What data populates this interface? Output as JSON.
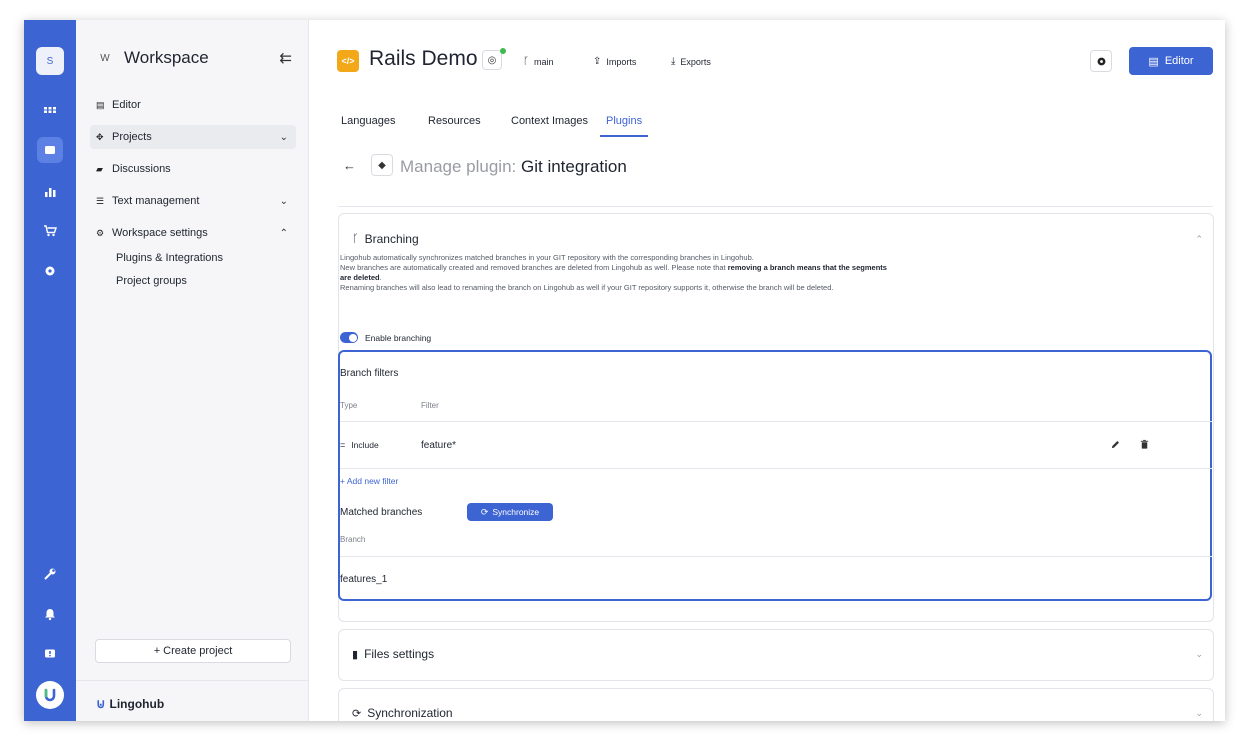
{
  "rail": {
    "avatar": "S",
    "colors": {
      "rail": "#3d64d3",
      "active": "#5d80e4"
    }
  },
  "sidebar": {
    "workspace_badge": "W",
    "workspace_title": "Workspace",
    "items": [
      {
        "label": "Editor",
        "icon": "editor-icon"
      },
      {
        "label": "Projects",
        "icon": "projects-icon",
        "expanded": false
      },
      {
        "label": "Discussions",
        "icon": "discussions-icon"
      },
      {
        "label": "Text management",
        "icon": "text-management-icon",
        "expanded": false
      },
      {
        "label": "Workspace settings",
        "icon": "settings-icon",
        "expanded": true
      }
    ],
    "sub_items": [
      "Plugins & Integrations",
      "Project groups"
    ],
    "create_project": "+ Create project",
    "brand": "Lingohub"
  },
  "header": {
    "project_title": "Rails Demo",
    "branch": "main",
    "imports": "Imports",
    "exports": "Exports",
    "editor_button": "Editor",
    "accent": "#3d64d3",
    "project_icon_color": "#f2a818"
  },
  "tabs": [
    {
      "label": "Languages",
      "active": false
    },
    {
      "label": "Resources",
      "active": false
    },
    {
      "label": "Context Images",
      "active": false
    },
    {
      "label": "Plugins",
      "active": true
    }
  ],
  "page": {
    "title_prefix": "Manage plugin:",
    "title_name": "Git integration"
  },
  "branching": {
    "title": "Branching",
    "desc1": "Lingohub automatically synchronizes matched branches in your GIT repository with the corresponding branches in Lingohub.",
    "desc2a": "New branches are automatically created and removed branches are deleted from Lingohub as well. Please note that ",
    "desc2b": "removing a branch means that the segments are deleted",
    "desc2c": ".",
    "desc3": "Renaming branches will also lead to renaming the branch on Lingohub as well if your GIT repository supports it, otherwise the branch will be deleted.",
    "toggle_label": "Enable branching",
    "toggle_on": true,
    "filters_title": "Branch filters",
    "col_type": "Type",
    "col_filter": "Filter",
    "filters": [
      {
        "type": "Include",
        "filter": "feature*"
      }
    ],
    "add_filter": "+ Add new filter",
    "matched_title": "Matched branches",
    "sync_button": "Synchronize",
    "col_branch": "Branch",
    "matched": [
      "features_1"
    ]
  },
  "sections": {
    "files_settings": "Files settings",
    "synchronization": "Synchronization"
  }
}
